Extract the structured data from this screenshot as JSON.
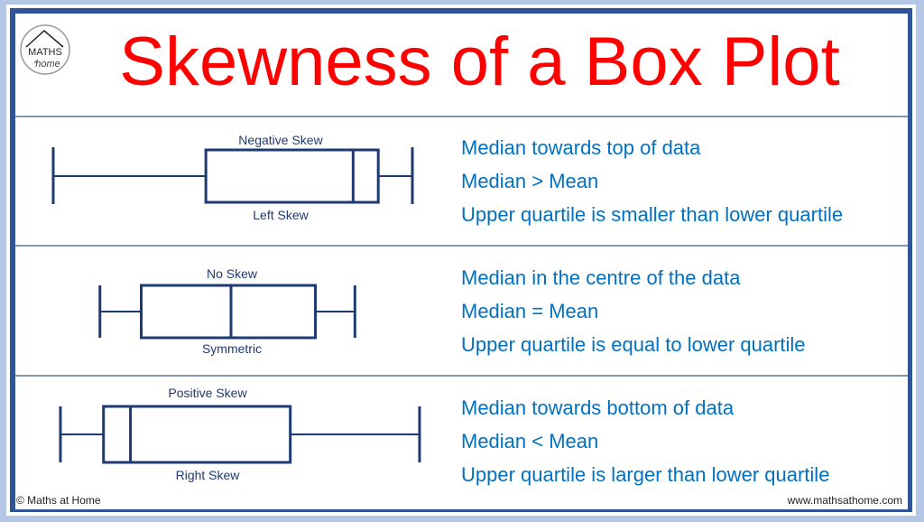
{
  "title": "Skewness of a Box Plot",
  "logo": {
    "line1": "MATHS",
    "line2": "at",
    "line3": "home",
    "icon": "house-roof-icon"
  },
  "colors": {
    "title": "#ff0000",
    "description": "#0070c0",
    "plot": "#1f3a73",
    "frame_outer": "#b4c7e7",
    "frame_inner": "#2f5597"
  },
  "rows": [
    {
      "label_top": "Negative Skew",
      "label_bottom": "Left Skew",
      "five_number": {
        "min": 0,
        "q1": 42.5,
        "median": 83.5,
        "q3": 90.5,
        "max": 100
      },
      "descriptions": [
        "Median towards top of data",
        "Median > Mean",
        "Upper quartile is smaller than lower quartile"
      ]
    },
    {
      "label_top": "No Skew",
      "label_bottom": "Symmetric",
      "five_number": {
        "min": 13,
        "q1": 24.5,
        "median": 49.5,
        "q3": 73,
        "max": 84
      },
      "descriptions": [
        "Median in the centre of the data",
        "Median = Mean",
        "Upper quartile is equal to lower quartile"
      ]
    },
    {
      "label_top": "Positive Skew",
      "label_bottom": "Right Skew",
      "five_number": {
        "min": 2,
        "q1": 14,
        "median": 21.5,
        "q3": 66,
        "max": 102
      },
      "descriptions": [
        "Median towards bottom of data",
        "Median < Mean",
        "Upper quartile is larger than lower quartile"
      ]
    }
  ],
  "footer": {
    "copyright": "© Maths at Home",
    "website": "www.mathsathome.com"
  }
}
